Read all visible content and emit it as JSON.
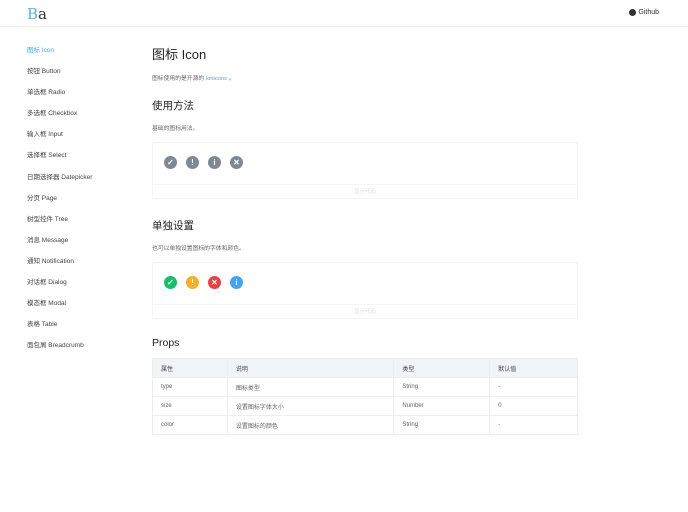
{
  "header": {
    "logo": {
      "b": "B",
      "a": "a"
    },
    "github": "Github"
  },
  "sidebar": {
    "items": [
      "图标 Icon",
      "按钮 Button",
      "单选框 Radio",
      "多选框 Checkbox",
      "输入框 Input",
      "选择框 Select",
      "日期选择器 Datepicker",
      "分页 Page",
      "树型控件 Tree",
      "消息 Message",
      "通知 Notification",
      "对话框 Dialog",
      "模态框 Modal",
      "表格 Table",
      "面包屑 Breadcrumb"
    ],
    "active": 0
  },
  "main": {
    "title": "图标 Icon",
    "intro_prefix": "图标使用的是开源的",
    "intro_link": "ionicons",
    "intro_suffix": " 。",
    "usage": {
      "title": "使用方法",
      "desc": "基础的图标用法。",
      "show_code": "显示代码",
      "icons": [
        {
          "name": "checkmark",
          "glyph": "✓",
          "color": "#7f8895"
        },
        {
          "name": "alert",
          "glyph": "!",
          "color": "#7f8895"
        },
        {
          "name": "information",
          "glyph": "i",
          "color": "#7f8895"
        },
        {
          "name": "close",
          "glyph": "✕",
          "color": "#7f8895"
        }
      ]
    },
    "custom": {
      "title": "单独设置",
      "desc": "也可以单独设置图标的字体和颜色。",
      "show_code": "显示代码",
      "icons": [
        {
          "name": "checkmark",
          "glyph": "✓",
          "color": "#19be6b"
        },
        {
          "name": "alert",
          "glyph": "!",
          "color": "#f5b02a"
        },
        {
          "name": "close",
          "glyph": "✕",
          "color": "#ed3f3f"
        },
        {
          "name": "information",
          "glyph": "i",
          "color": "#3fa4f5"
        }
      ]
    },
    "props": {
      "title": "Props",
      "headers": [
        "属性",
        "说明",
        "类型",
        "默认值"
      ],
      "rows": [
        [
          "type",
          "图标类型",
          "String",
          "-"
        ],
        [
          "size",
          "设置图标字体大小",
          "Number",
          "0"
        ],
        [
          "color",
          "设置图标的颜色",
          "String",
          "-"
        ]
      ]
    }
  }
}
